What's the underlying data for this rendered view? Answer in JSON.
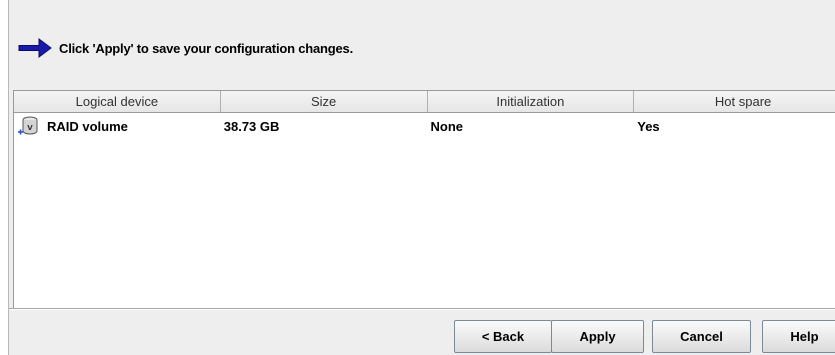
{
  "message": {
    "icon": "arrow-right-icon",
    "text": "Click 'Apply' to save your configuration changes."
  },
  "table": {
    "columns": [
      "Logical device",
      "Size",
      "Initialization",
      "Hot spare"
    ],
    "rows": [
      {
        "icon": "disk-volume-icon",
        "device": "RAID volume",
        "size": "38.73 GB",
        "initialization": "None",
        "hot_spare": "Yes"
      }
    ]
  },
  "buttons": {
    "back": "< Back",
    "apply": "Apply",
    "cancel": "Cancel",
    "help": "Help"
  },
  "colors": {
    "arrow": "#1a1aa8",
    "background": "#eeeeee"
  }
}
